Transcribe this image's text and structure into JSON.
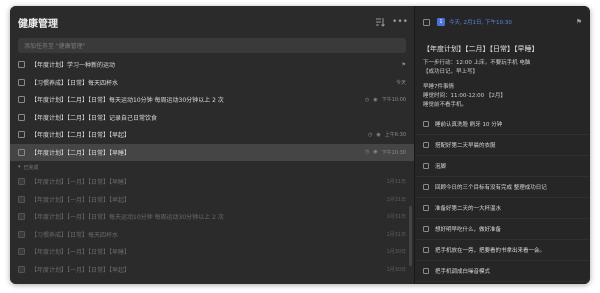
{
  "list": {
    "title": "健康管理",
    "add_placeholder": "添加任务至 \"健康管理\"",
    "tasks": [
      {
        "text": "【年度计划】学习一种新的运动",
        "meta": [
          "⚑"
        ]
      },
      {
        "text": "【习惯养成】【日常】每天四杯水",
        "meta": [
          "今天"
        ]
      },
      {
        "text": "【年度计划】【二月】【日常】每天运动10分钟 每周运动30分钟以上 2 次",
        "meta": [
          "◷",
          "◉",
          "下午10:00"
        ]
      },
      {
        "text": "【年度计划】【二月】【日常】记录自己日常饮食",
        "meta": []
      },
      {
        "text": "【年度计划】【二月】【日常】【早起】",
        "meta": [
          "◷",
          "◉",
          "上午6:30"
        ]
      },
      {
        "text": "【年度计划】【二月】【日常】【早睡】",
        "meta": [
          "◷",
          "◉",
          "下午10:30"
        ]
      }
    ],
    "completed_label": "已完成",
    "completed": [
      {
        "text": "【年度计划】【一月】【日常】【早睡】",
        "meta": "1月31日"
      },
      {
        "text": "【年度计划】【一月】【日常】【早起】",
        "meta": "1月31日"
      },
      {
        "text": "【年度计划】【一月】【日常】每天运动10分钟 每周运动30分钟以上 2 次",
        "meta": "1月31日"
      },
      {
        "text": "【习惯养成】【日常】每天四杯水",
        "meta": "1月31日"
      },
      {
        "text": "【年度计划】【一月】【日常】【早睡】",
        "meta": "1月30日"
      },
      {
        "text": "【年度计划】【一月】【日常】【早起】",
        "meta": "1月30日"
      }
    ]
  },
  "detail": {
    "date": "今天, 2月1日, 下午10:30",
    "title": "【年度计划】【二月】【日常】【早睡】",
    "note_lines": [
      "下一步行动：12:00 上床，不要玩手机 电脑",
      "【成功日记，早上写】"
    ],
    "note2_lines": [
      "早睡7件事情",
      "睡觉时间：11:00-12:00 【2月】",
      "睡觉前不看手机。"
    ],
    "subtasks": [
      "睡前认真洗脸 刷牙 10 分钟",
      "搭配好第二天早晨的衣服",
      "泡脚",
      "回顾今日的三个目标有没有完成 整理成功日记",
      "准备好第二天的一大杯温水",
      "想好明早吃什么，做好准备",
      "把手机放在一旁，把要看的书拿出来看一会。",
      "把手机调成白噪音模式"
    ]
  }
}
